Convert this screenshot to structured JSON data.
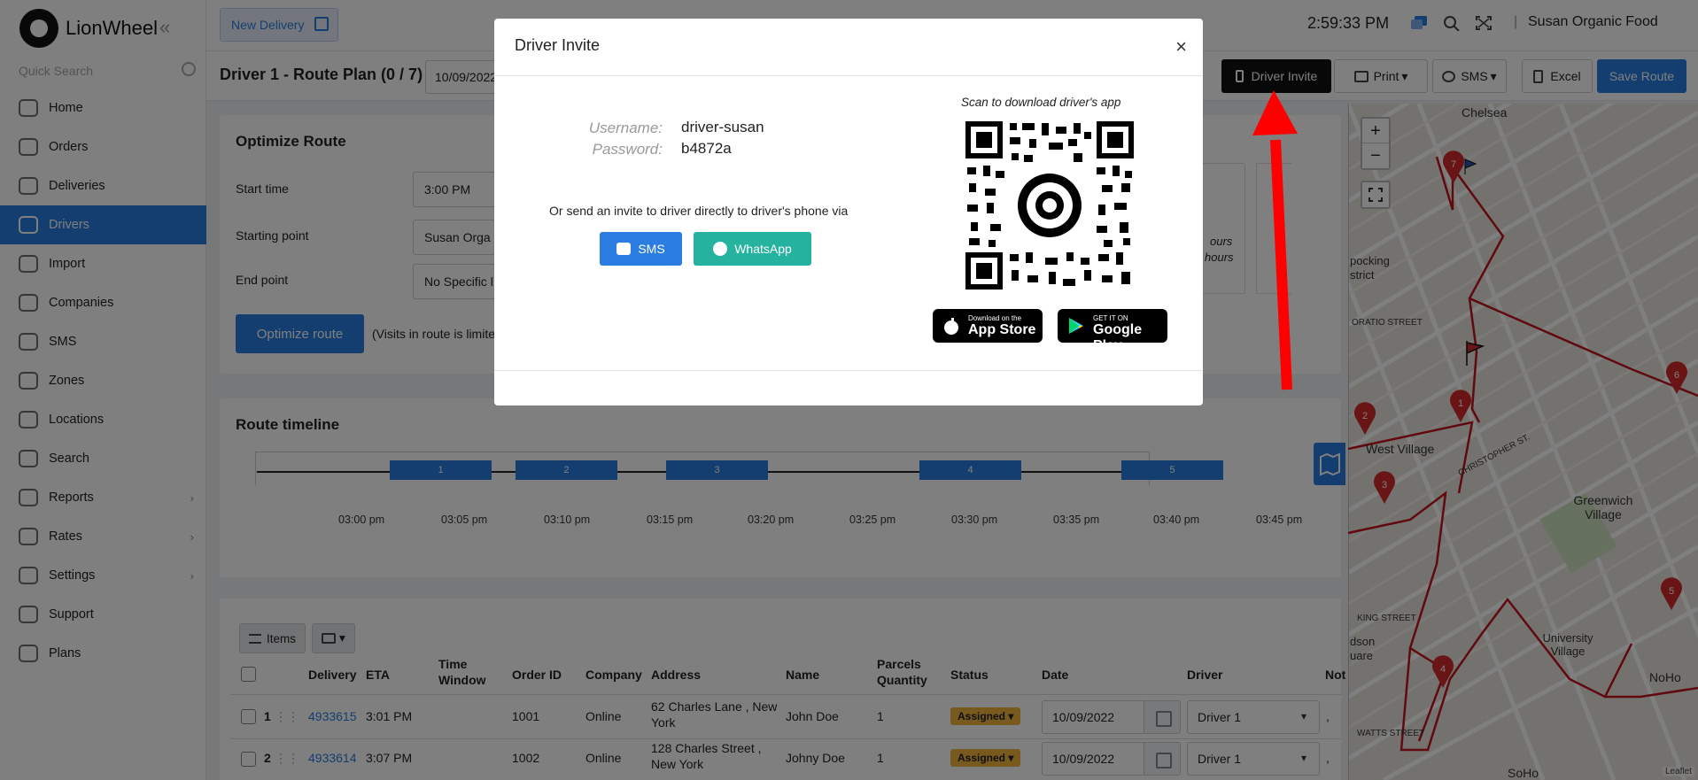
{
  "sidebar": {
    "brand": "LionWheel",
    "collapse_glyph": "«",
    "quick_search_placeholder": "Quick Search",
    "items": [
      {
        "label": "Home"
      },
      {
        "label": "Orders"
      },
      {
        "label": "Deliveries"
      },
      {
        "label": "Drivers"
      },
      {
        "label": "Import"
      },
      {
        "label": "Companies"
      },
      {
        "label": "SMS"
      },
      {
        "label": "Zones"
      },
      {
        "label": "Locations"
      },
      {
        "label": "Search"
      },
      {
        "label": "Reports"
      },
      {
        "label": "Rates"
      },
      {
        "label": "Settings"
      },
      {
        "label": "Support"
      },
      {
        "label": "Plans"
      }
    ],
    "chevron": "›"
  },
  "topbar": {
    "new_delivery_label": "New Delivery",
    "clock": "2:59:33 PM",
    "separator": "|",
    "user_name": "Susan Organic Food"
  },
  "subheader": {
    "title": "Driver 1 - Route Plan (0 / 7)",
    "date": "10/09/2022",
    "partial_button": "n",
    "driver_invite_label": "Driver Invite",
    "print_label": "Print",
    "sms_label": "SMS",
    "excel_label": "Excel",
    "save_route_label": "Save Route",
    "chevron": "▾"
  },
  "optimize": {
    "title": "Optimize Route",
    "start_time_label": "Start time",
    "start_time_value": "3:00 PM",
    "starting_point_label": "Starting point",
    "starting_point_value": "Susan Orga",
    "end_point_label": "End point",
    "end_point_value": "No Specific l",
    "button_label": "Optimize route",
    "note": "(Visits in route is limite",
    "hours_1": "ours",
    "hours_2": "hours"
  },
  "timeline": {
    "title": "Route timeline",
    "blocks": [
      "1",
      "2",
      "3",
      "4",
      "5"
    ],
    "ticks": [
      "03:00 pm",
      "03:05 pm",
      "03:10 pm",
      "03:15 pm",
      "03:20 pm",
      "03:25 pm",
      "03:30 pm",
      "03:35 pm",
      "03:40 pm",
      "03:45 pm"
    ]
  },
  "table": {
    "items_label": "Items",
    "columns": {
      "delivery": "Delivery",
      "eta": "ETA",
      "time_window_1": "Time",
      "time_window_2": "Window",
      "order_id": "Order ID",
      "company": "Company",
      "address": "Address",
      "name": "Name",
      "parcels_1": "Parcels",
      "parcels_2": "Quantity",
      "status": "Status",
      "date": "Date",
      "driver": "Driver",
      "notes": "Not"
    },
    "rows": [
      {
        "index": "1",
        "delivery": "4933615",
        "eta": "3:01 PM",
        "order_id": "1001",
        "company": "Online",
        "address_1": "62 Charles Lane , New",
        "address_2": "York",
        "name": "John Doe",
        "parcels": "1",
        "status": "Assigned ▾",
        "date": "10/09/2022",
        "driver": "Driver 1",
        "notes": ","
      },
      {
        "index": "2",
        "delivery": "4933614",
        "eta": "3:07 PM",
        "order_id": "1002",
        "company": "Online",
        "address_1": "128 Charles Street ,",
        "address_2": "New York",
        "name": "Johny Doe",
        "parcels": "1",
        "status": "Assigned ▾",
        "date": "10/09/2022",
        "driver": "Driver 1",
        "notes": ","
      }
    ]
  },
  "map": {
    "labels": [
      "Chelsea",
      "West Village",
      "Greenwich Village",
      "University Village",
      "NoHo",
      "SoHo",
      "pocking",
      "strict",
      "ORATIO STREET",
      "CHRISTOPHER ST.",
      "KING STREET",
      "WATTS STREET",
      "dson",
      "uare"
    ],
    "markers": [
      "7",
      "1",
      "2",
      "3",
      "4",
      "5",
      "6"
    ],
    "zoom_in": "+",
    "zoom_out": "−",
    "attribution": "Leaflet"
  },
  "modal": {
    "title": "Driver Invite",
    "close_glyph": "×",
    "username_label": "Username:",
    "username_value": "driver-susan",
    "password_label": "Password:",
    "password_value": "b4872a",
    "send_text": "Or send an invite to driver directly to driver's phone via",
    "sms_button": "SMS",
    "whatsapp_button": "WhatsApp",
    "scan_text": "Scan to download driver's app",
    "app_store_small": "Download on the",
    "app_store_big": "App Store",
    "google_small": "GET IT ON",
    "google_big": "Google Play"
  },
  "colors": {
    "accent": "#2b7de1",
    "whatsapp": "#25b3a0",
    "arrow": "#ff0000",
    "marker": "#d22b2b",
    "status_badge": "#f0b43c"
  }
}
